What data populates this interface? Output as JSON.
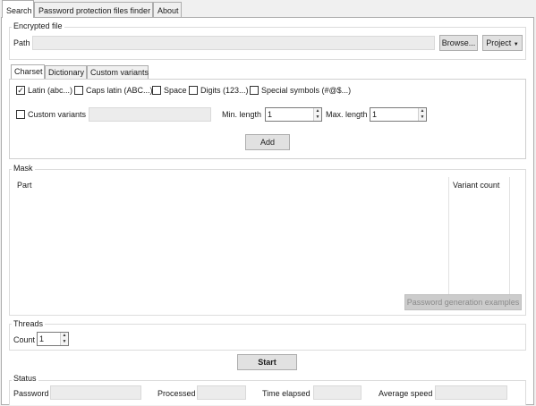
{
  "tabs": [
    {
      "label": "Search",
      "active": true
    },
    {
      "label": "Password protection files finder",
      "active": false
    },
    {
      "label": "About",
      "active": false
    }
  ],
  "encrypted_file": {
    "title": "Encrypted file",
    "path_label": "Path",
    "path_value": "",
    "browse_label": "Browse...",
    "project_label": "Project"
  },
  "charset_tabs": [
    {
      "label": "Charset",
      "active": true
    },
    {
      "label": "Dictionary",
      "active": false
    },
    {
      "label": "Custom variants",
      "active": false
    }
  ],
  "charset": {
    "options": [
      {
        "label": "Latin (abc...)",
        "checked": true
      },
      {
        "label": "Caps latin (ABC...)",
        "checked": false
      },
      {
        "label": "Space",
        "checked": false
      },
      {
        "label": "Digits (123...)",
        "checked": false
      },
      {
        "label": "Special symbols (#@$...)",
        "checked": false
      }
    ],
    "custom_variants_label": "Custom variants",
    "custom_variants_checked": false,
    "custom_variants_value": "",
    "min_length_label": "Min. length",
    "min_length_value": "1",
    "max_length_label": "Max. length",
    "max_length_value": "1",
    "add_label": "Add"
  },
  "mask": {
    "title": "Mask",
    "columns": [
      "Part",
      "Variant count"
    ],
    "examples_label": "Password generation examples"
  },
  "threads": {
    "title": "Threads",
    "count_label": "Count",
    "count_value": "1"
  },
  "start_label": "Start",
  "status": {
    "title": "Status",
    "password_label": "Password",
    "password_value": "",
    "processed_label": "Processed",
    "processed_value": "",
    "time_elapsed_label": "Time elapsed",
    "time_elapsed_value": "",
    "average_speed_label": "Average speed",
    "average_speed_value": ""
  },
  "icons": {
    "check": "check-icon",
    "dropdown": "caret-down-icon",
    "spin_up": "spin-up-icon",
    "spin_down": "spin-down-icon"
  }
}
